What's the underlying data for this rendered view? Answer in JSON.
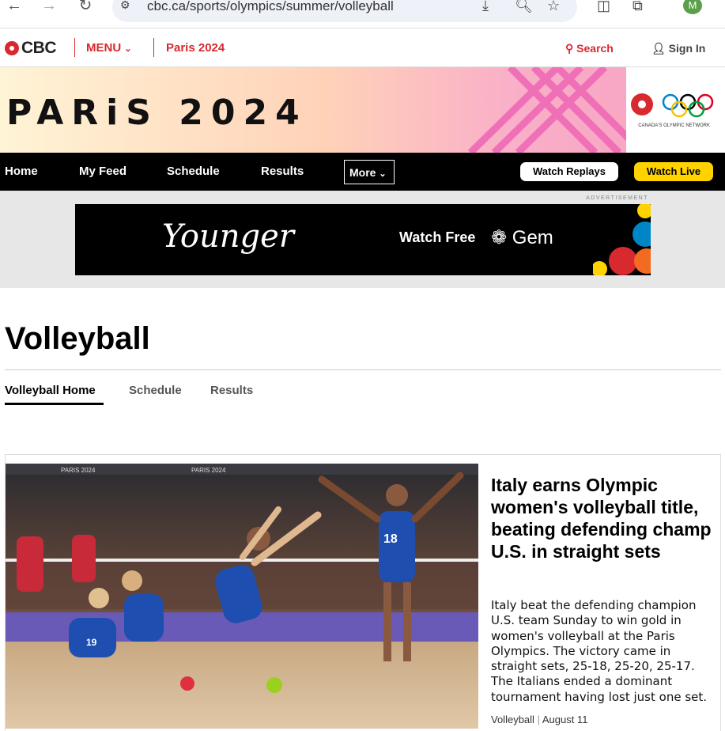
{
  "browser": {
    "url": "cbc.ca/sports/olympics/summer/volleyball",
    "avatar_letter": "M"
  },
  "header": {
    "logo_text": "CBC",
    "menu_label": "MENU",
    "paris_label": "Paris 2024",
    "search_label": "Search",
    "signin_label": "Sign In"
  },
  "banner": {
    "title": "PARiS 2024",
    "network_text": "CANADA'S OLYMPIC NETWORK"
  },
  "olympic_nav": {
    "items": [
      "Home",
      "My Feed",
      "Schedule",
      "Results"
    ],
    "more_label": "More",
    "replays_label": "Watch Replays",
    "live_label": "Watch Live"
  },
  "ad": {
    "label": "ADVERTISEMENT",
    "brand_text": "Younger",
    "watch_text": "Watch Free",
    "gem_text": "Gem"
  },
  "page": {
    "title": "Volleyball",
    "tabs": [
      "Volleyball Home",
      "Schedule",
      "Results"
    ]
  },
  "story": {
    "headline": "Italy earns Olympic women's volleyball title, beating defending champ U.S. in straight sets",
    "summary": "Italy beat the defending champion U.S. team Sunday to win gold in women's volleyball at the Paris Olympics. The victory came in straight sets, 25-18, 25-20, 25-17. The Italians ended a dominant tournament having lost just one set.",
    "category": "Volleyball",
    "date": "August 11",
    "image_banner_text": "PARIS 2024",
    "jersey_number": "18",
    "jersey_number_2": "19"
  },
  "colors": {
    "cbc_red": "#d8292f",
    "watch_live_yellow": "#ffd200",
    "nav_black": "#000000"
  }
}
